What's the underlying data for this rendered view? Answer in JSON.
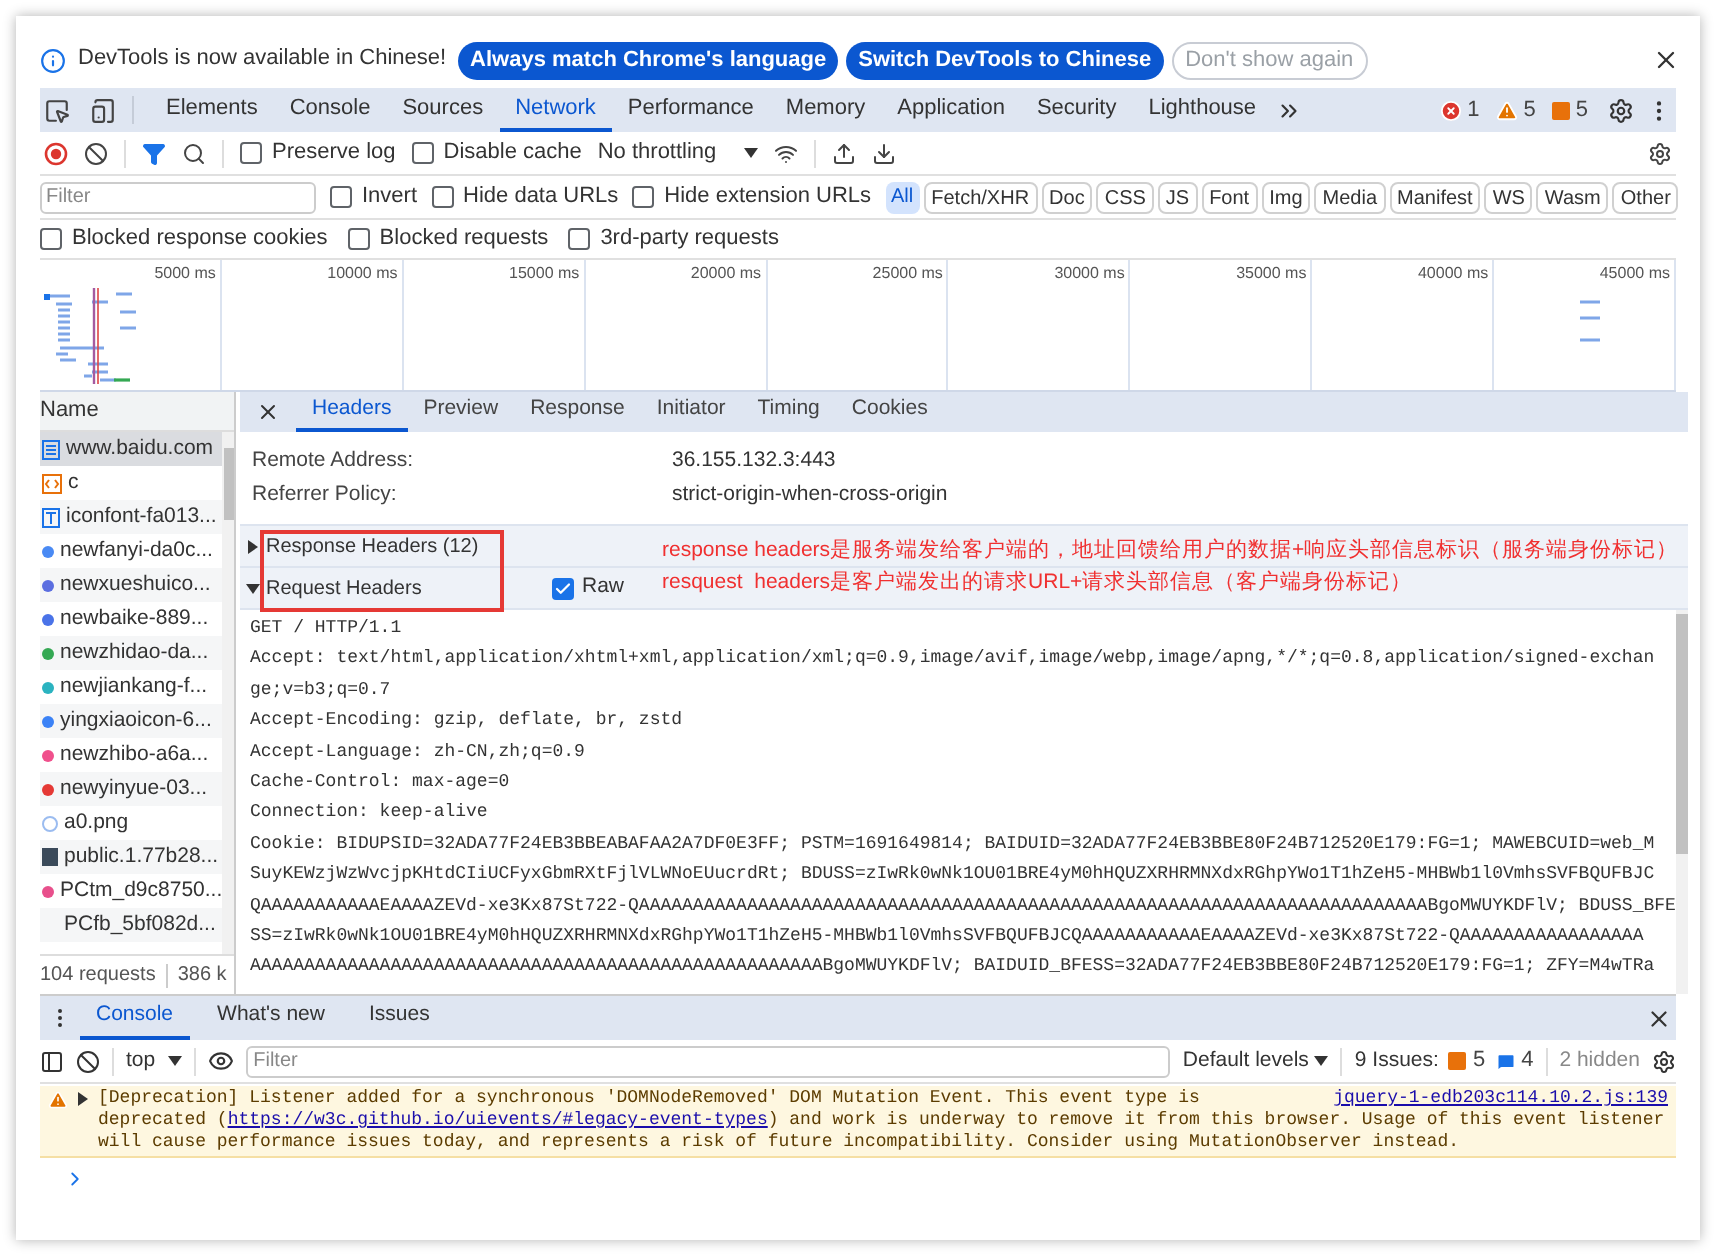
{
  "infobar": {
    "message": "DevTools is now available in Chinese!",
    "buttons": [
      {
        "label": "Always match Chrome's language",
        "kind": "primary"
      },
      {
        "label": "Switch DevTools to Chinese",
        "kind": "primary"
      },
      {
        "label": "Don't show again",
        "kind": "secondary"
      }
    ]
  },
  "panel_tabs": [
    {
      "label": "Elements",
      "selected": false
    },
    {
      "label": "Console",
      "selected": false
    },
    {
      "label": "Sources",
      "selected": false
    },
    {
      "label": "Network",
      "selected": true
    },
    {
      "label": "Performance",
      "selected": false
    },
    {
      "label": "Memory",
      "selected": false
    },
    {
      "label": "Application",
      "selected": false
    },
    {
      "label": "Security",
      "selected": false
    },
    {
      "label": "Lighthouse",
      "selected": false
    }
  ],
  "counters": [
    {
      "kind": "error",
      "count": "1"
    },
    {
      "kind": "warning",
      "count": "5"
    },
    {
      "kind": "issue",
      "count": "5"
    }
  ],
  "toolbar": {
    "recording": true,
    "filter_active": true,
    "options": [
      {
        "label": "Preserve log",
        "checked": false
      },
      {
        "label": "Disable cache",
        "checked": false
      }
    ],
    "throttling": "No throttling"
  },
  "filter": {
    "placeholder": "Filter",
    "options": [
      {
        "label": "Invert",
        "checked": false
      },
      {
        "label": "Hide data URLs",
        "checked": false
      },
      {
        "label": "Hide extension URLs",
        "checked": false
      }
    ],
    "types": [
      {
        "label": "All",
        "selected": true
      },
      {
        "label": "Fetch/XHR",
        "selected": false
      },
      {
        "label": "Doc",
        "selected": false
      },
      {
        "label": "CSS",
        "selected": false
      },
      {
        "label": "JS",
        "selected": false
      },
      {
        "label": "Font",
        "selected": false
      },
      {
        "label": "Img",
        "selected": false
      },
      {
        "label": "Media",
        "selected": false
      },
      {
        "label": "Manifest",
        "selected": false
      },
      {
        "label": "WS",
        "selected": false
      },
      {
        "label": "Wasm",
        "selected": false
      },
      {
        "label": "Other",
        "selected": false
      }
    ]
  },
  "blocked_options": [
    {
      "label": "Blocked response cookies",
      "checked": false
    },
    {
      "label": "Blocked requests",
      "checked": false
    },
    {
      "label": "3rd-party requests",
      "checked": false
    }
  ],
  "overview": {
    "ticks": [
      "5000 ms",
      "10000 ms",
      "15000 ms",
      "20000 ms",
      "25000 ms",
      "30000 ms",
      "35000 ms",
      "40000 ms",
      "45000 ms"
    ]
  },
  "requests": {
    "header": "Name",
    "items": [
      {
        "name": "www.baidu.com",
        "kind": "document",
        "selected": true
      },
      {
        "name": "c",
        "kind": "code",
        "selected": false
      },
      {
        "name": "iconfont-fa013...",
        "kind": "font",
        "selected": false
      },
      {
        "name": "newfanyi-da0c...",
        "kind": "image",
        "color": "#4a8af4",
        "selected": false
      },
      {
        "name": "newxueshuico...",
        "kind": "image",
        "color": "#5b6ee0",
        "selected": false
      },
      {
        "name": "newbaike-889...",
        "kind": "image",
        "color": "#4a73e8",
        "selected": false
      },
      {
        "name": "newzhidao-da...",
        "kind": "image",
        "color": "#34a853",
        "selected": false
      },
      {
        "name": "newjiankang-f...",
        "kind": "image",
        "color": "#2bb3c0",
        "selected": false
      },
      {
        "name": "yingxiaoicon-6...",
        "kind": "image",
        "color": "#3b82f6",
        "selected": false
      },
      {
        "name": "newzhibo-a6a...",
        "kind": "image",
        "color": "#f0508c",
        "selected": false
      },
      {
        "name": "newyinyue-03...",
        "kind": "image",
        "color": "#e53935",
        "selected": false
      },
      {
        "name": "a0.png",
        "kind": "outline",
        "color": "#9bbcf0",
        "selected": false
      },
      {
        "name": "public.1.77b28...",
        "kind": "photo",
        "selected": false
      },
      {
        "name": "PCtm_d9c8750...",
        "kind": "image",
        "color": "#e8508c",
        "selected": false
      },
      {
        "name": "PCfb_5bf082d...",
        "kind": "blank",
        "selected": false
      }
    ],
    "count": "104 requests",
    "transferred": "386 k"
  },
  "details": {
    "tabs": [
      {
        "label": "Headers",
        "selected": true
      },
      {
        "label": "Preview",
        "selected": false
      },
      {
        "label": "Response",
        "selected": false
      },
      {
        "label": "Initiator",
        "selected": false
      },
      {
        "label": "Timing",
        "selected": false
      },
      {
        "label": "Cookies",
        "selected": false
      }
    ],
    "general": [
      {
        "label": "Remote Address:",
        "value": "36.155.132.3:443"
      },
      {
        "label": "Referrer Policy:",
        "value": "strict-origin-when-cross-origin"
      }
    ],
    "sections": [
      {
        "title": "Response Headers (12)",
        "expanded": false
      },
      {
        "title": "Request Headers",
        "expanded": true,
        "raw": {
          "label": "Raw",
          "checked": true
        }
      }
    ],
    "raw_lines": [
      "GET / HTTP/1.1",
      "Accept: text/html,application/xhtml+xml,application/xml;q=0.9,image/avif,image/webp,image/apng,*/*;q=0.8,application/signed-exchan",
      "ge;v=b3;q=0.7",
      "Accept-Encoding: gzip, deflate, br, zstd",
      "Accept-Language: zh-CN,zh;q=0.9",
      "Cache-Control: max-age=0",
      "Connection: keep-alive",
      "Cookie: BIDUPSID=32ADA77F24EB3BBEABAFAA2A7DF0E3FF; PSTM=1691649814; BAIDUID=32ADA77F24EB3BBE80F24B712520E179:FG=1; MAWEBCUID=web_M",
      "SuyKEWzjWzWvcjpKHtdCIiUCFyxGbmRXtFjlVLWNoEUucrdRt; BDUSS=zIwRk0wNk1OU01BRE4yM0hHQUZXRHRMNXdxRGhpYWo1T1hZeH5-MHBWb1l0VmhsSVFBQUFBJC",
      "QAAAAAAAAAAAEAAAAZEVd-xe3Kx87St722-QAAAAAAAAAAAAAAAAAAAAAAAAAAAAAAAAAAAAAAAAAAAAAAAAAAAAAAAAAAAAAAAAAAAAAAAAABgoMWUYKDFlV; BDUSS_BFE",
      "SS=zIwRk0wNk1OU01BRE4yM0hHQUZXRHRMNXdxRGhpYWo1T1hZeH5-MHBWb1l0VmhsSVFBQUFBJCQAAAAAAAAAAAEAAAAZEVd-xe3Kx87St722-QAAAAAAAAAAAAAAAAA",
      "AAAAAAAAAAAAAAAAAAAAAAAAAAAAAAAAAAAAAAAAAAAAAAAAAAAAABgoMWUYKDFlV; BAIDUID_BFESS=32ADA77F24EB3BBE80F24B712520E179:FG=1; ZFY=M4wTRa"
    ]
  },
  "annotation": {
    "lines": [
      "response headers是服务端发给客户端的，地址回馈给用户的数据+响应头部信息标识（服务端身份标记）",
      "resquest  headers是客户端发出的请求URL+请求头部信息（客户端身份标记）"
    ]
  },
  "drawer": {
    "tabs": [
      {
        "label": "Console",
        "selected": true
      },
      {
        "label": "What's new",
        "selected": false
      },
      {
        "label": "Issues",
        "selected": false
      }
    ],
    "context": "top",
    "filter_placeholder": "Filter",
    "levels": "Default levels",
    "issues_label": "9 Issues:",
    "issue_counts": [
      {
        "kind": "issue",
        "count": "5"
      },
      {
        "kind": "info",
        "count": "4"
      }
    ],
    "hidden": "2 hidden",
    "message": {
      "first_line": "[Deprecation] Listener added for a synchronous 'DOMNodeRemoved' DOM Mutation Event. This event type is",
      "text_before": "deprecated (",
      "link": "https://w3c.github.io/uievents/#legacy-event-types",
      "text_after": ") and work is underway to remove it from this browser. Usage of this event listener will cause performance issues today, and represents a risk of future incompatibility. Consider using MutationObserver instead.",
      "source": "jquery-1-edb203c114.10.2.js:139"
    }
  }
}
